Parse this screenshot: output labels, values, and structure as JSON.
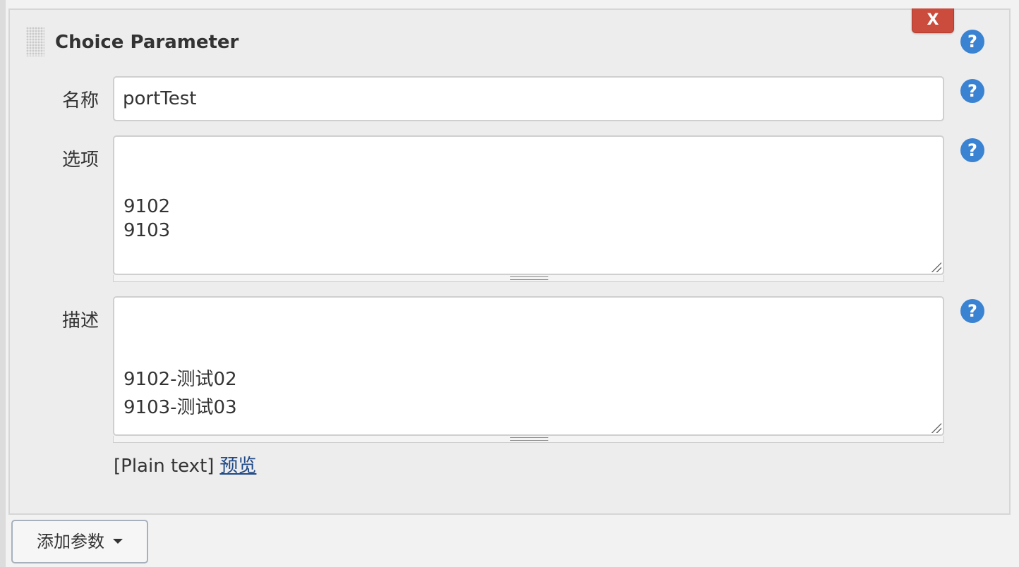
{
  "parameter": {
    "title": "Choice Parameter",
    "delete_label": "X",
    "help_glyph": "?",
    "name": {
      "label": "名称",
      "value": "portTest"
    },
    "choices": {
      "label": "选项",
      "lines": [
        "9102",
        "9103"
      ]
    },
    "description": {
      "label": "描述",
      "lines": [
        "9102-测试02",
        "9103-测试03"
      ]
    },
    "format_note": "[Plain text]",
    "preview_link": "预览"
  },
  "add_button": {
    "label": "添加参数"
  },
  "colors": {
    "delete_button": "#cb4c3c",
    "help_icon": "#3a82d2",
    "link": "#204a87",
    "panel_bg": "#ededed"
  },
  "icons": {
    "help": "question-circle-icon",
    "drag": "drag-handle-icon",
    "dropdown": "caret-down-icon"
  }
}
